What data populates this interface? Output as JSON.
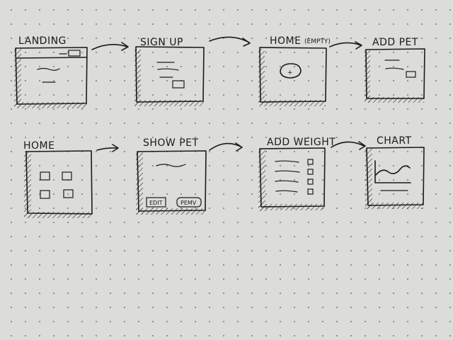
{
  "wireframes": {
    "landing": {
      "label": "LANDING"
    },
    "sign_up": {
      "label": "SIGN UP"
    },
    "home_empty": {
      "label": "HOME",
      "suffix": "(EMPTY)",
      "plus": "+"
    },
    "add_pet": {
      "label": "ADD PET"
    },
    "home": {
      "label": "HOME"
    },
    "show_pet": {
      "label": "SHOW PET",
      "edit_button": "EDIT",
      "remove_button": "PEMV"
    },
    "add_weight": {
      "label": "ADD WEIGHT"
    },
    "chart": {
      "label": "CHART"
    }
  },
  "colors": {
    "paper": "#dcdcda",
    "ink": "#1b1b1b",
    "dots": "#8a8a86"
  }
}
